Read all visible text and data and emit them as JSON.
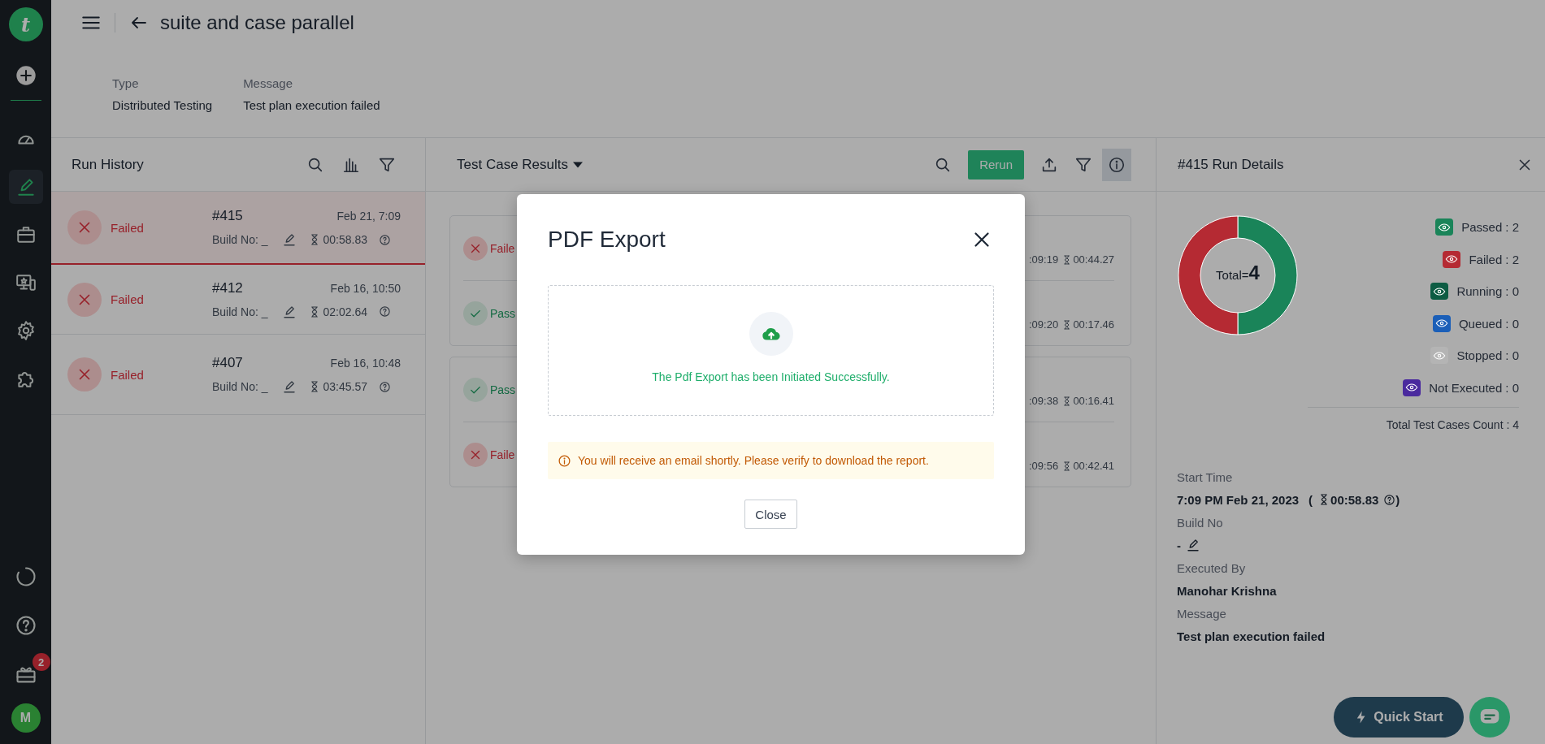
{
  "sidebar": {
    "brand_mark": "t",
    "items": [
      {
        "selected": false
      },
      {
        "selected": true
      },
      {
        "selected": false
      },
      {
        "selected": false
      },
      {
        "selected": false
      },
      {
        "selected": false
      }
    ],
    "bottom_badge": "2",
    "avatar_initial": "M"
  },
  "header": {
    "title": "suite and case parallel",
    "meta": [
      {
        "label": "Type",
        "value": "Distributed Testing"
      },
      {
        "label": "Message",
        "value": "Test plan execution failed"
      }
    ]
  },
  "run_history": {
    "title": "Run History",
    "rows": [
      {
        "kind": "failed",
        "status": "Failed",
        "id": "#415",
        "date": "Feb 21, 7:09",
        "build": "Build No: _",
        "duration": "00:58.83",
        "selected": true
      },
      {
        "kind": "failed",
        "status": "Failed",
        "id": "#412",
        "date": "Feb 16, 10:50",
        "build": "Build No: _",
        "duration": "02:02.64",
        "selected": false
      },
      {
        "kind": "failed",
        "status": "Failed",
        "id": "#407",
        "date": "Feb 16, 10:48",
        "build": "Build No: _",
        "duration": "03:45.57",
        "selected": false
      }
    ]
  },
  "results": {
    "title": "Test Case Results",
    "rerun": "Rerun",
    "info_button": {
      "selected": true
    },
    "groups": [
      {
        "rows": [
          {
            "kind": "failed",
            "status": "Faile",
            "time": ":09:19",
            "duration": "00:44.27"
          },
          {
            "kind": "passed",
            "status": "Pass",
            "time": ":09:20",
            "duration": "00:17.46"
          }
        ]
      },
      {
        "rows": [
          {
            "kind": "passed",
            "status": "Pass",
            "time": ":09:38",
            "duration": "00:16.41"
          },
          {
            "kind": "failed",
            "status": "Faile",
            "time": ":09:56",
            "duration": "00:42.41"
          }
        ]
      }
    ]
  },
  "run_details": {
    "title": "#415 Run Details",
    "chart_data": {
      "type": "donut",
      "categories": [
        "Passed",
        "Failed"
      ],
      "values": [
        50,
        50
      ]
    },
    "total_label": "Total=",
    "total_value": "4",
    "legend": [
      {
        "value": ": 2",
        "color": "#1a8459"
      },
      {
        "value": ": 2",
        "color": "#b52a33"
      },
      {
        "label": "Running",
        "value": ": 0",
        "color": "#0d5c43"
      },
      {
        "label": "Queued",
        "value": ": 0",
        "color": "#1b5fb8"
      },
      {
        "label": "Stopped",
        "value": ": 0",
        "color": "#b4b4b4"
      },
      {
        "label": "Not Executed",
        "value": ": 0",
        "color": "#4a2a9e"
      }
    ],
    "total_count": "Total Test Cases Count : 4",
    "fields": [
      {
        "kind": "time",
        "label": "Start Time",
        "value": "7:09 PM Feb 21, 2023",
        "paren_open": "(",
        "duration": "00:58.83",
        "paren_close": ")"
      },
      {
        "kind": "build",
        "label": "Build No",
        "value": "-"
      },
      {
        "kind": "text",
        "label": "Executed By",
        "value": "Manohar Krishna"
      },
      {
        "kind": "text",
        "label": "Message",
        "value": "Test plan execution failed"
      }
    ]
  },
  "quick_start": "Quick Start",
  "modal": {
    "title": "PDF Export",
    "message": "The Pdf Export has been Initiated Successfully.",
    "notice": "You will receive an email shortly. Please verify to download the report.",
    "close_button": "Close"
  }
}
